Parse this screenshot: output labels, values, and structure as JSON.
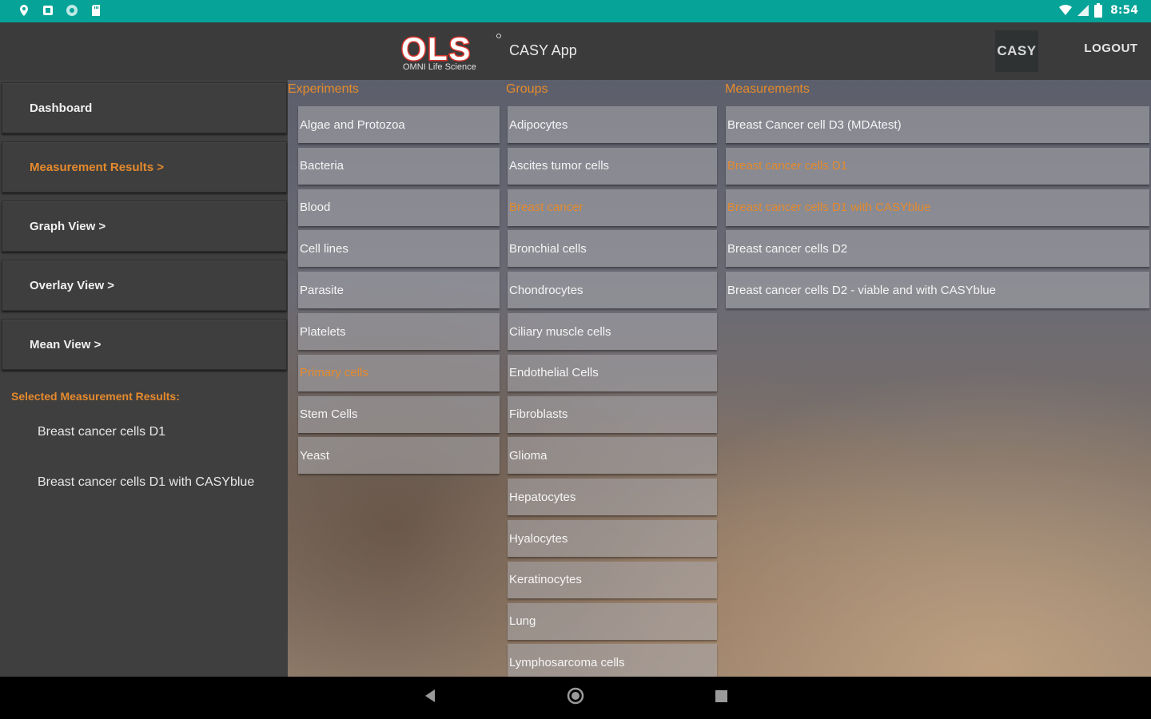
{
  "status_bar": {
    "time": "8:54",
    "left_icons": [
      "location-icon",
      "square-notification-icon",
      "circle-notification-icon",
      "sd-card-icon"
    ],
    "right_icons": [
      "wifi-icon",
      "signal-icon",
      "battery-icon"
    ]
  },
  "app_bar": {
    "logo_text": "OLS",
    "logo_subtext": "OMNI Life Science",
    "title": "CASY App",
    "casy_label": "CASY",
    "logout_label": "LOGOUT"
  },
  "sidebar": {
    "nav": [
      {
        "label": "Dashboard",
        "active": false
      },
      {
        "label": "Measurement Results >",
        "active": true
      },
      {
        "label": "Graph View >",
        "active": false
      },
      {
        "label": "Overlay View >",
        "active": false
      },
      {
        "label": "Mean View >",
        "active": false
      }
    ],
    "selected_title": "Selected Measurement Results:",
    "selected_items": [
      "Breast cancer cells D1",
      "Breast cancer cells D1 with CASYblue"
    ]
  },
  "main": {
    "experiments": {
      "header": "Experiments",
      "items": [
        "Algae and Protozoa",
        "Bacteria",
        "Blood",
        "Cell lines",
        "Parasite",
        "Platelets",
        "Primary cells",
        "Stem Cells",
        "Yeast"
      ],
      "highlighted": "Primary cells"
    },
    "groups": {
      "header": "Groups",
      "items": [
        "Adipocytes",
        "Ascites tumor cells",
        "Breast cancer",
        "Bronchial cells",
        "Chondrocytes",
        "Ciliary muscle cells",
        "Endothelial Cells",
        "Fibroblasts",
        "Glioma",
        "Hepatocytes",
        "Hyalocytes",
        "Keratinocytes",
        "Lung",
        "Lymphosarcoma cells"
      ],
      "highlighted": "Breast cancer"
    },
    "measurements": {
      "header": "Measurements",
      "items": [
        "Breast Cancer cell D3 (MDAtest)",
        "Breast cancer cells D1",
        "Breast cancer cells D1 with CASYblue",
        "Breast cancer cells D2",
        "Breast cancer cells D2 - viable and with CASYblue"
      ],
      "highlighted": [
        "Breast cancer cells D1",
        "Breast cancer cells D1 with CASYblue"
      ]
    }
  },
  "nav_bar": {
    "icons": [
      "back-icon",
      "home-icon",
      "recents-icon"
    ]
  },
  "colors": {
    "status_bar": "#05a398",
    "accent": "#e58a2d",
    "sidebar": "#3f3f3f",
    "app_bar": "#3b3b3b"
  }
}
